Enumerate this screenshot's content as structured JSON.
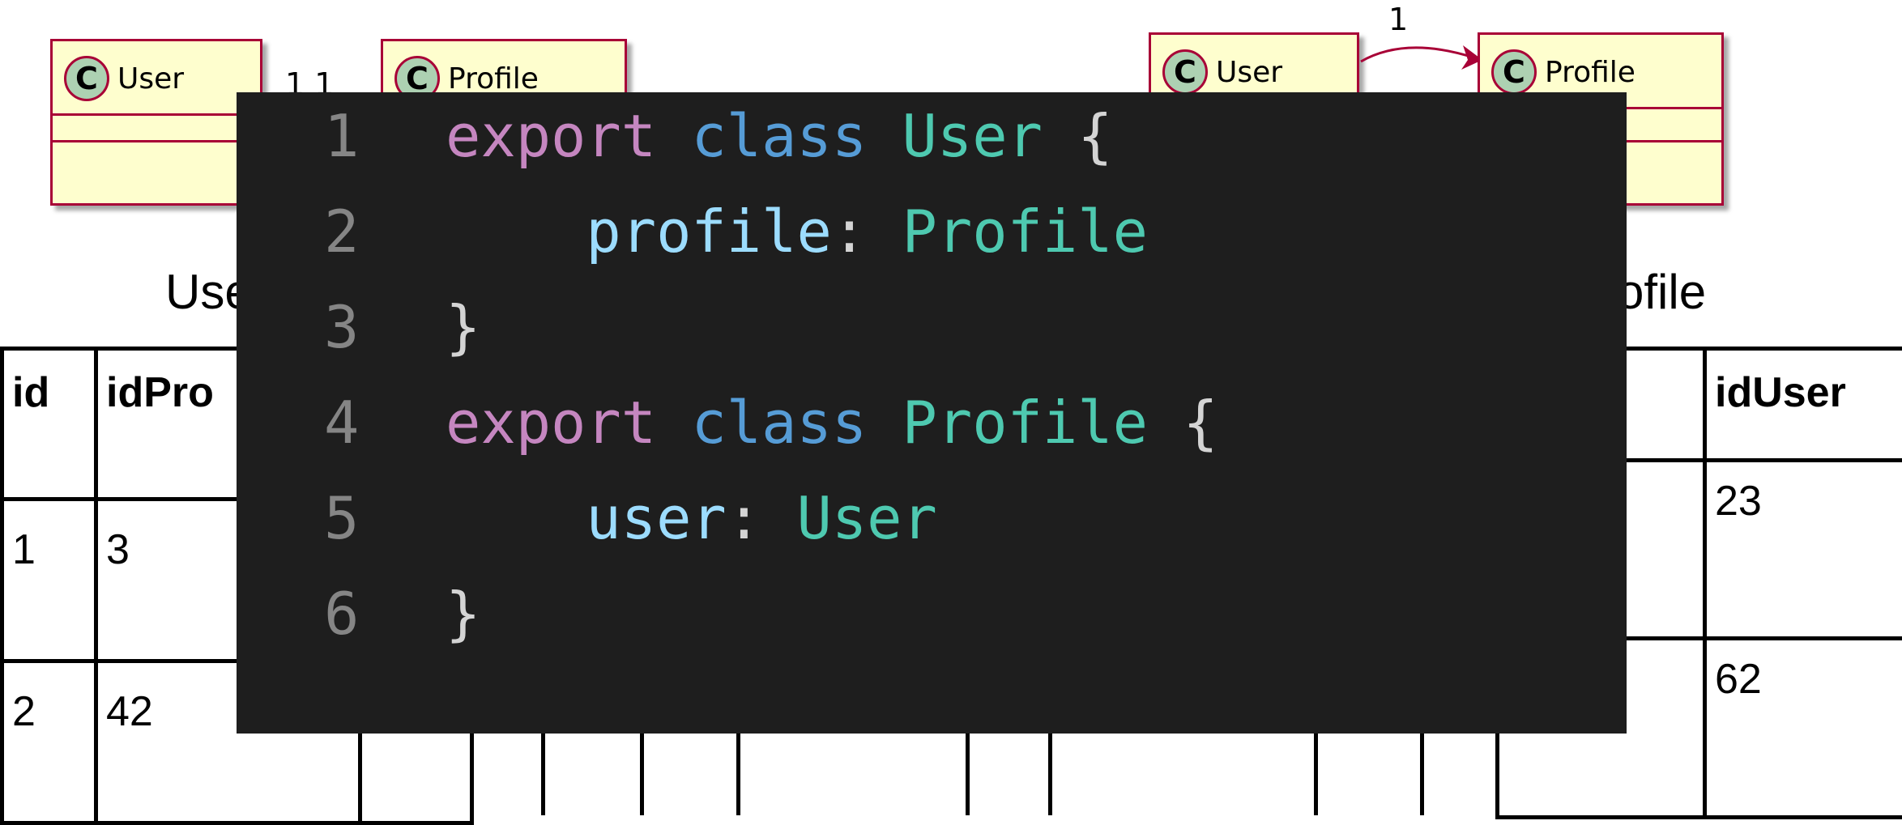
{
  "left_diagram": {
    "class_a": "User",
    "class_b": "Profile",
    "stereotype": "C",
    "multiplicity": "1 1",
    "caption": "Use"
  },
  "right_diagram": {
    "class_a": "User",
    "class_b": "Profile",
    "stereotype": "C",
    "multiplicity": "1",
    "caption": "ofile"
  },
  "left_table": {
    "headers": [
      "id",
      "idPro"
    ],
    "rows": [
      [
        "1",
        "3"
      ],
      [
        "2",
        "42"
      ]
    ]
  },
  "right_table": {
    "header": "idUser",
    "rows": [
      "23",
      "62"
    ]
  },
  "code": {
    "lines": [
      {
        "n": "1",
        "indent": "",
        "tokens": [
          {
            "t": "export ",
            "c": "kw-export"
          },
          {
            "t": "class ",
            "c": "kw-class"
          },
          {
            "t": "User",
            "c": "type"
          },
          {
            "t": " {",
            "c": "punc"
          }
        ]
      },
      {
        "n": "2",
        "indent": "    ",
        "tokens": [
          {
            "t": "profile",
            "c": "prop"
          },
          {
            "t": ": ",
            "c": "punc"
          },
          {
            "t": "Profile",
            "c": "type"
          }
        ]
      },
      {
        "n": "3",
        "indent": "",
        "tokens": [
          {
            "t": "}",
            "c": "punc"
          }
        ]
      },
      {
        "n": "4",
        "indent": "",
        "tokens": [
          {
            "t": "export ",
            "c": "kw-export"
          },
          {
            "t": "class ",
            "c": "kw-class"
          },
          {
            "t": "Profile",
            "c": "type"
          },
          {
            "t": " {",
            "c": "punc"
          }
        ]
      },
      {
        "n": "5",
        "indent": "    ",
        "tokens": [
          {
            "t": "user",
            "c": "prop"
          },
          {
            "t": ": ",
            "c": "punc"
          },
          {
            "t": "User",
            "c": "type"
          }
        ]
      },
      {
        "n": "6",
        "indent": "",
        "tokens": [
          {
            "t": "}",
            "c": "punc"
          }
        ]
      }
    ]
  },
  "colors": {
    "uml_fill": "#fefece",
    "uml_border": "#a80036",
    "uml_badge": "#add1b2",
    "code_bg": "#1e1e1e",
    "keyword_export": "#c586c0",
    "keyword_class": "#569cd6",
    "type": "#4ec9b0",
    "property": "#9cdcfe"
  }
}
